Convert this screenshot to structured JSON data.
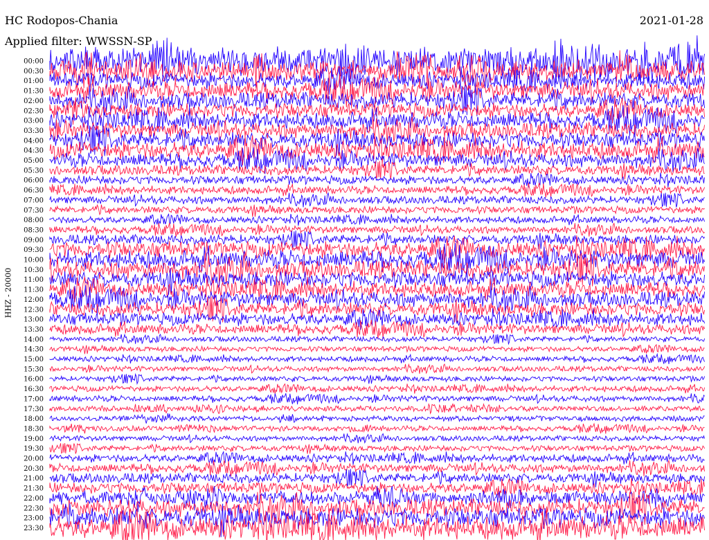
{
  "header": {
    "station": "HC Rodopos-Chania",
    "date": "2021-01-28",
    "filter": "Applied filter: WWSSN-SP"
  },
  "chart_data": {
    "type": "line",
    "title": "HC Rodopos-Chania",
    "channel_label": "HHZ - 20000",
    "x_unit": "minutes",
    "x_range": [
      0,
      30
    ],
    "rows": [
      {
        "label": "00:00",
        "color": "#2200ff",
        "level": 0.95
      },
      {
        "label": "00:30",
        "color": "#ff1a47",
        "level": 0.7
      },
      {
        "label": "01:00",
        "color": "#2200ff",
        "level": 0.55
      },
      {
        "label": "01:30",
        "color": "#ff1a47",
        "level": 0.6
      },
      {
        "label": "02:00",
        "color": "#2200ff",
        "level": 0.55
      },
      {
        "label": "02:30",
        "color": "#ff1a47",
        "level": 0.5
      },
      {
        "label": "03:00",
        "color": "#2200ff",
        "level": 0.55
      },
      {
        "label": "03:30",
        "color": "#ff1a47",
        "level": 0.5
      },
      {
        "label": "04:00",
        "color": "#2200ff",
        "level": 0.55
      },
      {
        "label": "04:30",
        "color": "#ff1a47",
        "level": 0.6
      },
      {
        "label": "05:00",
        "color": "#2200ff",
        "level": 0.45
      },
      {
        "label": "05:30",
        "color": "#ff1a47",
        "level": 0.3
      },
      {
        "label": "06:00",
        "color": "#2200ff",
        "level": 0.25
      },
      {
        "label": "06:30",
        "color": "#ff1a47",
        "level": 0.22
      },
      {
        "label": "07:00",
        "color": "#2200ff",
        "level": 0.22
      },
      {
        "label": "07:30",
        "color": "#ff1a47",
        "level": 0.2
      },
      {
        "label": "08:00",
        "color": "#2200ff",
        "level": 0.18
      },
      {
        "label": "08:30",
        "color": "#ff1a47",
        "level": 0.2
      },
      {
        "label": "09:00",
        "color": "#2200ff",
        "level": 0.3
      },
      {
        "label": "09:30",
        "color": "#ff1a47",
        "level": 0.55
      },
      {
        "label": "10:00",
        "color": "#2200ff",
        "level": 0.6
      },
      {
        "label": "10:30",
        "color": "#ff1a47",
        "level": 0.6
      },
      {
        "label": "11:00",
        "color": "#2200ff",
        "level": 0.55
      },
      {
        "label": "11:30",
        "color": "#ff1a47",
        "level": 0.5
      },
      {
        "label": "12:00",
        "color": "#2200ff",
        "level": 0.5
      },
      {
        "label": "12:30",
        "color": "#ff1a47",
        "level": 0.45
      },
      {
        "label": "13:00",
        "color": "#2200ff",
        "level": 0.4
      },
      {
        "label": "13:30",
        "color": "#ff1a47",
        "level": 0.3
      },
      {
        "label": "14:00",
        "color": "#2200ff",
        "level": 0.12
      },
      {
        "label": "14:30",
        "color": "#ff1a47",
        "level": 0.12
      },
      {
        "label": "15:00",
        "color": "#2200ff",
        "level": 0.12
      },
      {
        "label": "15:30",
        "color": "#ff1a47",
        "level": 0.12
      },
      {
        "label": "16:00",
        "color": "#2200ff",
        "level": 0.12
      },
      {
        "label": "16:30",
        "color": "#ff1a47",
        "level": 0.14
      },
      {
        "label": "17:00",
        "color": "#2200ff",
        "level": 0.14
      },
      {
        "label": "17:30",
        "color": "#ff1a47",
        "level": 0.12
      },
      {
        "label": "18:00",
        "color": "#2200ff",
        "level": 0.12
      },
      {
        "label": "18:30",
        "color": "#ff1a47",
        "level": 0.12
      },
      {
        "label": "19:00",
        "color": "#2200ff",
        "level": 0.12
      },
      {
        "label": "19:30",
        "color": "#ff1a47",
        "level": 0.14
      },
      {
        "label": "20:00",
        "color": "#2200ff",
        "level": 0.22
      },
      {
        "label": "20:30",
        "color": "#ff1a47",
        "level": 0.25
      },
      {
        "label": "21:00",
        "color": "#2200ff",
        "level": 0.3
      },
      {
        "label": "21:30",
        "color": "#ff1a47",
        "level": 0.35
      },
      {
        "label": "22:00",
        "color": "#2200ff",
        "level": 0.45
      },
      {
        "label": "22:30",
        "color": "#ff1a47",
        "level": 0.6
      },
      {
        "label": "23:00",
        "color": "#2200ff",
        "level": 0.7
      },
      {
        "label": "23:30",
        "color": "#ff1a47",
        "level": 0.8
      }
    ]
  }
}
